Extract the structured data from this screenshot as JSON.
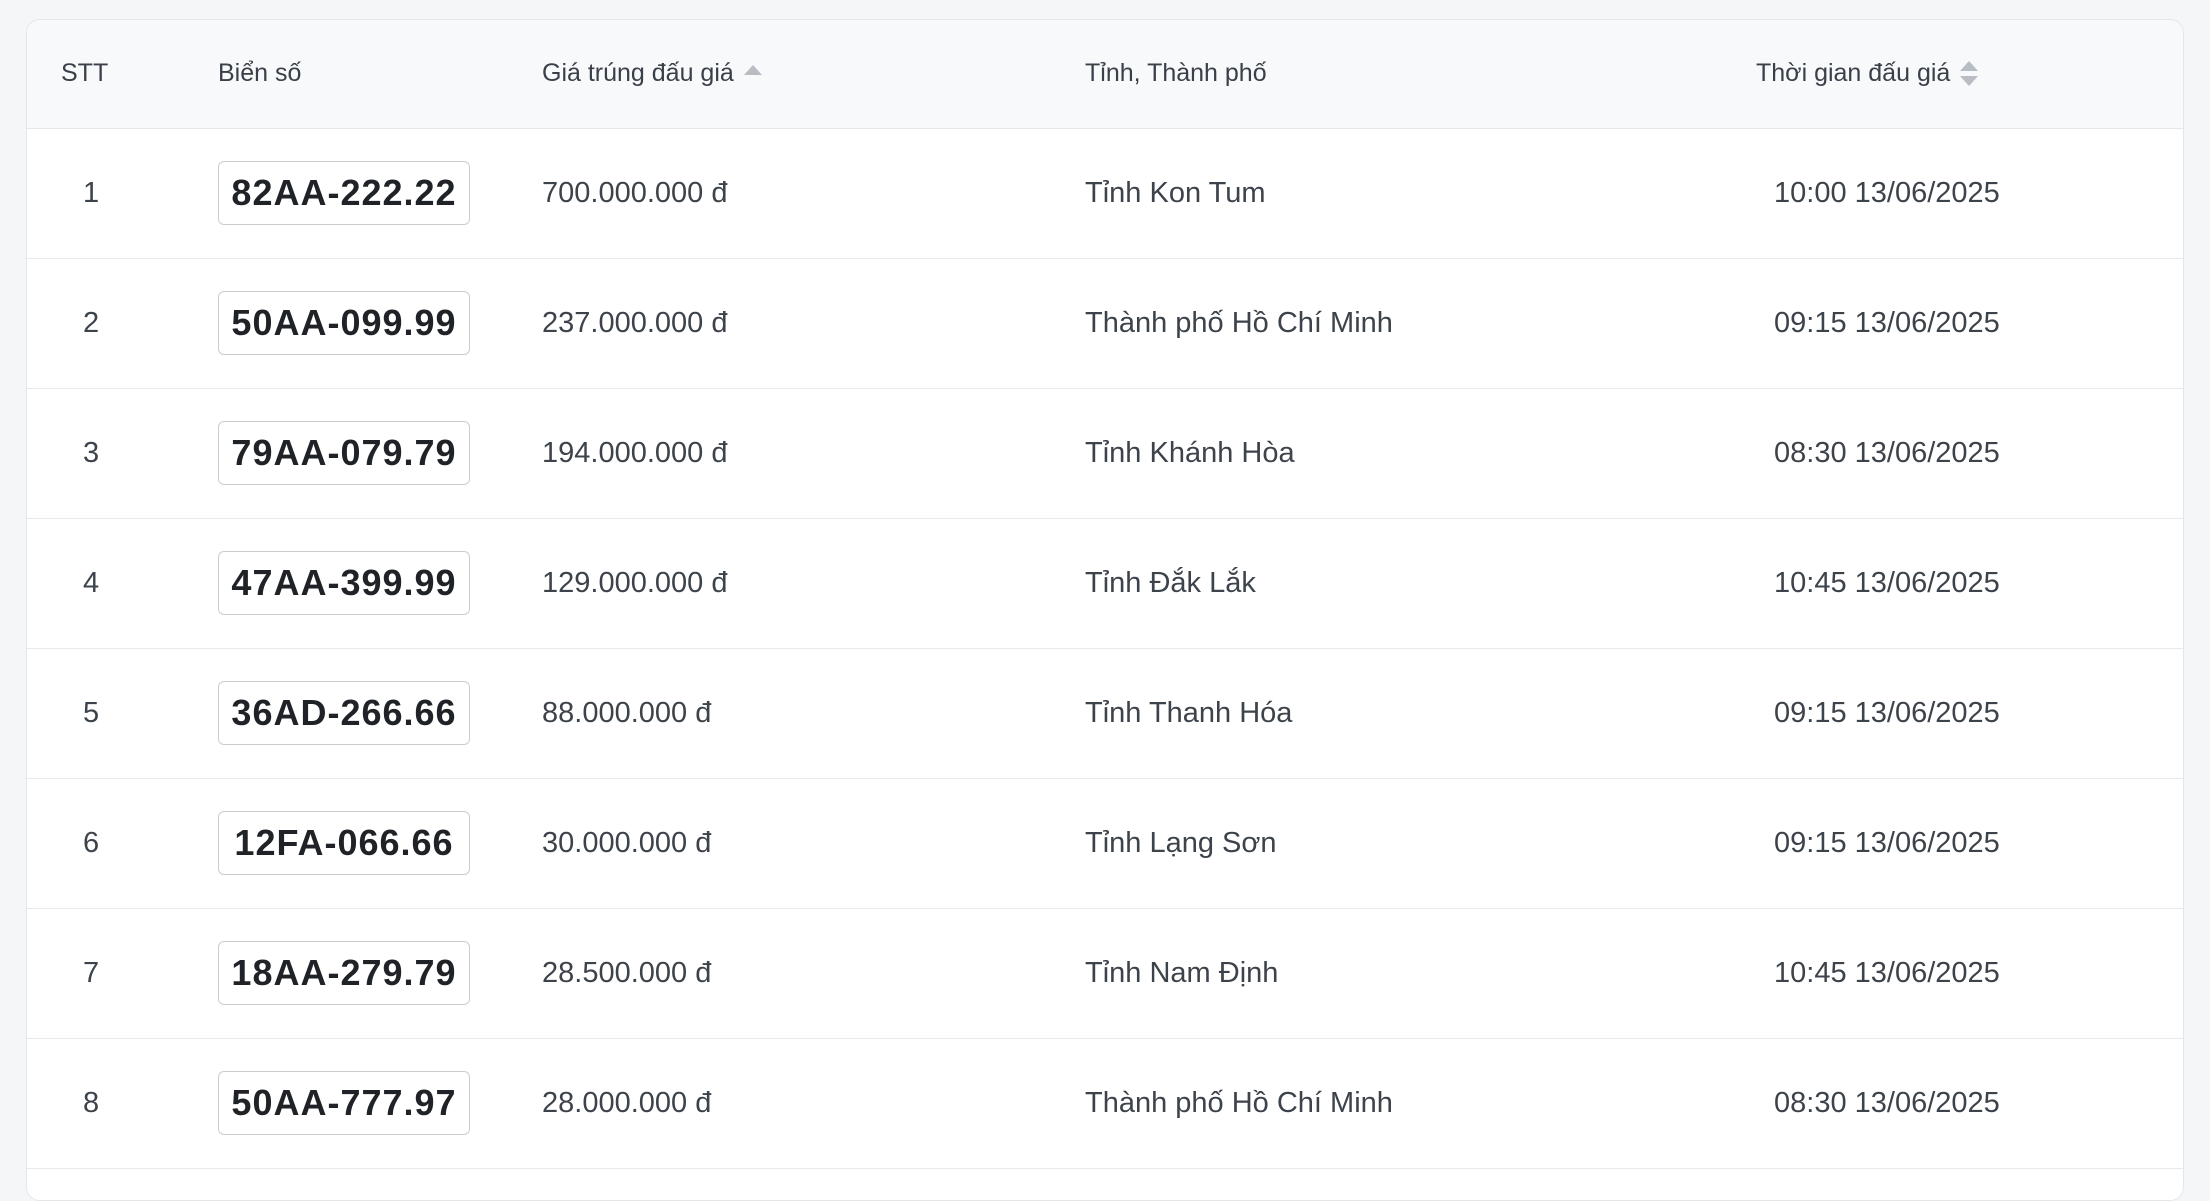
{
  "table": {
    "headers": {
      "stt": "STT",
      "plate": "Biển số",
      "price": "Giá trúng đấu giá",
      "province": "Tỉnh, Thành phố",
      "time": "Thời gian đấu giá"
    },
    "sort_icons": {
      "price": "sort-ascending-icon",
      "time": "sort-both-icon"
    },
    "rows": [
      {
        "stt": "1",
        "plate": "82AA-222.22",
        "price": "700.000.000 đ",
        "province": "Tỉnh Kon Tum",
        "time": "10:00 13/06/2025"
      },
      {
        "stt": "2",
        "plate": "50AA-099.99",
        "price": "237.000.000 đ",
        "province": "Thành phố Hồ Chí Minh",
        "time": "09:15 13/06/2025"
      },
      {
        "stt": "3",
        "plate": "79AA-079.79",
        "price": "194.000.000 đ",
        "province": "Tỉnh Khánh Hòa",
        "time": "08:30 13/06/2025"
      },
      {
        "stt": "4",
        "plate": "47AA-399.99",
        "price": "129.000.000 đ",
        "province": "Tỉnh Đắk Lắk",
        "time": "10:45 13/06/2025"
      },
      {
        "stt": "5",
        "plate": "36AD-266.66",
        "price": "88.000.000 đ",
        "province": "Tỉnh Thanh Hóa",
        "time": "09:15 13/06/2025"
      },
      {
        "stt": "6",
        "plate": "12FA-066.66",
        "price": "30.000.000 đ",
        "province": "Tỉnh Lạng Sơn",
        "time": "09:15 13/06/2025"
      },
      {
        "stt": "7",
        "plate": "18AA-279.79",
        "price": "28.500.000 đ",
        "province": "Tỉnh Nam Định",
        "time": "10:45 13/06/2025"
      },
      {
        "stt": "8",
        "plate": "50AA-777.97",
        "price": "28.000.000 đ",
        "province": "Thành phố Hồ Chí Minh",
        "time": "08:30 13/06/2025"
      }
    ]
  },
  "colors": {
    "background": "#f4f6f8",
    "header_bg": "#f8f9fa",
    "border": "#e6e9ed",
    "text": "#3d434b",
    "plate_border": "#c9cdd2"
  }
}
